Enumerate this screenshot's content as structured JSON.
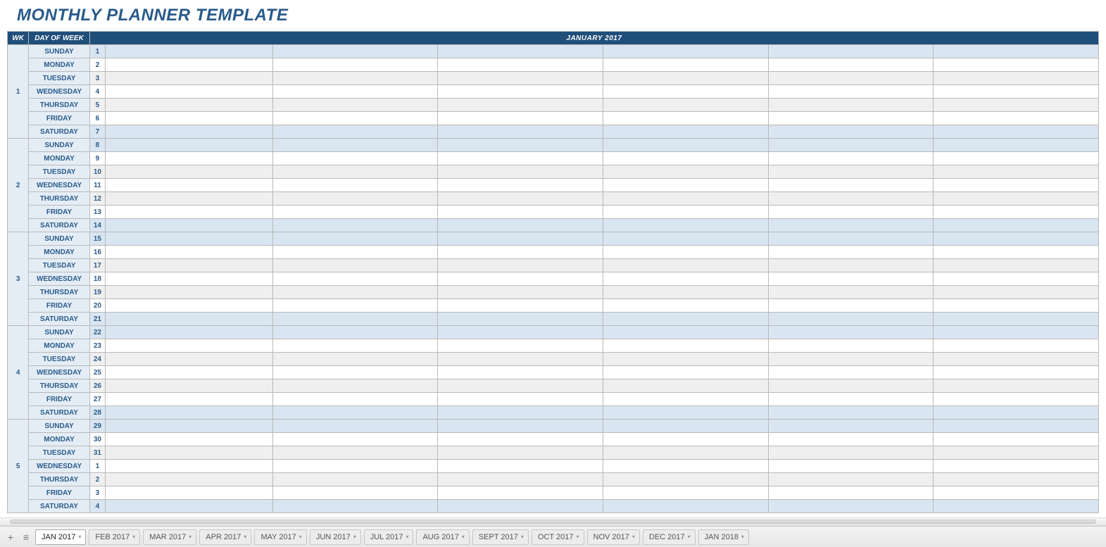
{
  "title": "MONTHLY PLANNER TEMPLATE",
  "header": {
    "wk": "WK",
    "dayOfWeek": "DAY OF WEEK",
    "month": "JANUARY 2017"
  },
  "days": [
    "SUNDAY",
    "MONDAY",
    "TUESDAY",
    "WEDNESDAY",
    "THURSDAY",
    "FRIDAY",
    "SATURDAY"
  ],
  "weeks": [
    {
      "num": "1",
      "dates": [
        "1",
        "2",
        "3",
        "4",
        "5",
        "6",
        "7"
      ]
    },
    {
      "num": "2",
      "dates": [
        "8",
        "9",
        "10",
        "11",
        "12",
        "13",
        "14"
      ]
    },
    {
      "num": "3",
      "dates": [
        "15",
        "16",
        "17",
        "18",
        "19",
        "20",
        "21"
      ]
    },
    {
      "num": "4",
      "dates": [
        "22",
        "23",
        "24",
        "25",
        "26",
        "27",
        "28"
      ]
    },
    {
      "num": "5",
      "dates": [
        "29",
        "30",
        "31",
        "1",
        "2",
        "3",
        "4"
      ]
    }
  ],
  "sheetTabs": [
    {
      "label": "JAN 2017",
      "active": true
    },
    {
      "label": "FEB 2017",
      "active": false
    },
    {
      "label": "MAR 2017",
      "active": false
    },
    {
      "label": "APR 2017",
      "active": false
    },
    {
      "label": "MAY 2017",
      "active": false
    },
    {
      "label": "JUN 2017",
      "active": false
    },
    {
      "label": "JUL 2017",
      "active": false
    },
    {
      "label": "AUG 2017",
      "active": false
    },
    {
      "label": "SEPT 2017",
      "active": false
    },
    {
      "label": "OCT 2017",
      "active": false
    },
    {
      "label": "NOV 2017",
      "active": false
    },
    {
      "label": "DEC 2017",
      "active": false
    },
    {
      "label": "JAN 2018",
      "active": false
    }
  ]
}
